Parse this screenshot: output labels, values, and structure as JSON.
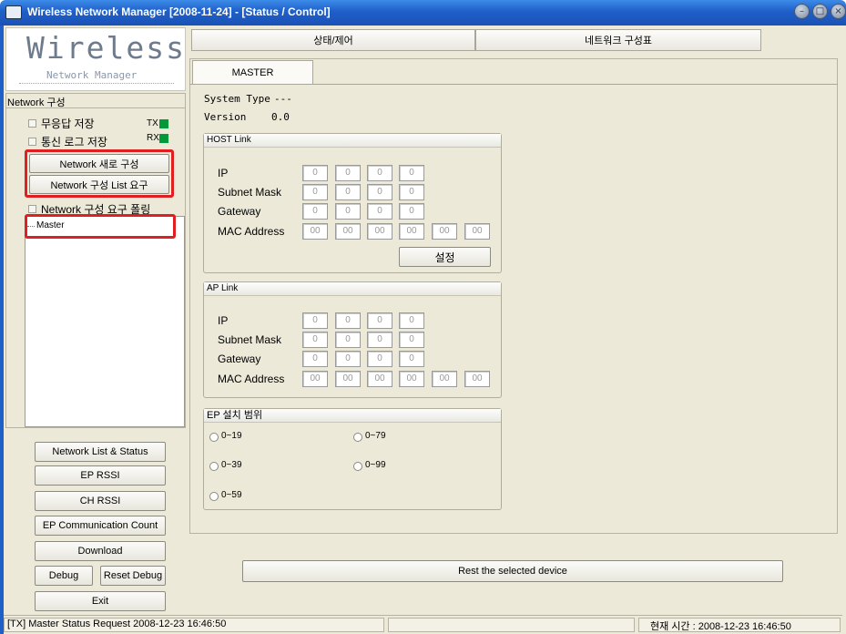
{
  "window": {
    "title": "Wireless Network Manager [2008-11-24] - [Status / Control]",
    "controls": [
      "minimize-icon",
      "maximize-icon",
      "close-icon"
    ]
  },
  "logo": {
    "main": "Wireless",
    "sub": "Network Manager"
  },
  "left": {
    "section_label": "Network 구성",
    "checkbox_no_response": "무응답 저장",
    "checkbox_comm_log": "통신 로그 저장",
    "tx_label": "TX",
    "rx_label": "RX",
    "btn_new_config": "Network 새로 구성",
    "btn_request_list": "Network 구성 List 요구",
    "checkbox_polling": "Network 구성 요구 폴링",
    "tree_item": "Master",
    "buttons": {
      "list_status": "Network List & Status",
      "ep_rssi": "EP RSSI",
      "ch_rssi": "CH RSSI",
      "ep_comm": "EP Communication Count",
      "download": "Download",
      "debug": "Debug",
      "reset_debug": "Reset Debug",
      "exit": "Exit"
    }
  },
  "tabs": {
    "status": "상태/제어",
    "network": "네트워크 구성표",
    "subtab": "MASTER"
  },
  "system": {
    "type_label": "System Type",
    "type_value": "---",
    "version_label": "Version",
    "version_value": "0.0"
  },
  "host": {
    "title": "HOST Link",
    "ip_label": "IP",
    "subnet_label": "Subnet Mask",
    "gateway_label": "Gateway",
    "mac_label": "MAC Address",
    "ip": [
      "0",
      "0",
      "0",
      "0"
    ],
    "subnet": [
      "0",
      "0",
      "0",
      "0"
    ],
    "gateway": [
      "0",
      "0",
      "0",
      "0"
    ],
    "mac": [
      "00",
      "00",
      "00",
      "00",
      "00",
      "00"
    ],
    "set_button": "설정"
  },
  "ap": {
    "title": "AP Link",
    "ip_label": "IP",
    "subnet_label": "Subnet Mask",
    "gateway_label": "Gateway",
    "mac_label": "MAC Address",
    "ip": [
      "0",
      "0",
      "0",
      "0"
    ],
    "subnet": [
      "0",
      "0",
      "0",
      "0"
    ],
    "gateway": [
      "0",
      "0",
      "0",
      "0"
    ],
    "mac": [
      "00",
      "00",
      "00",
      "00",
      "00",
      "00"
    ]
  },
  "ep": {
    "title": "EP 설치 범위",
    "r19": "0~19",
    "r39": "0~39",
    "r59": "0~59",
    "r79": "0~79",
    "r99": "0~99"
  },
  "reset_button": "Rest the selected device",
  "status": {
    "left": "[TX] Master  Status Request 2008-12-23 16:46:50",
    "right": "현재 시간 : 2008-12-23 16:46:50"
  }
}
